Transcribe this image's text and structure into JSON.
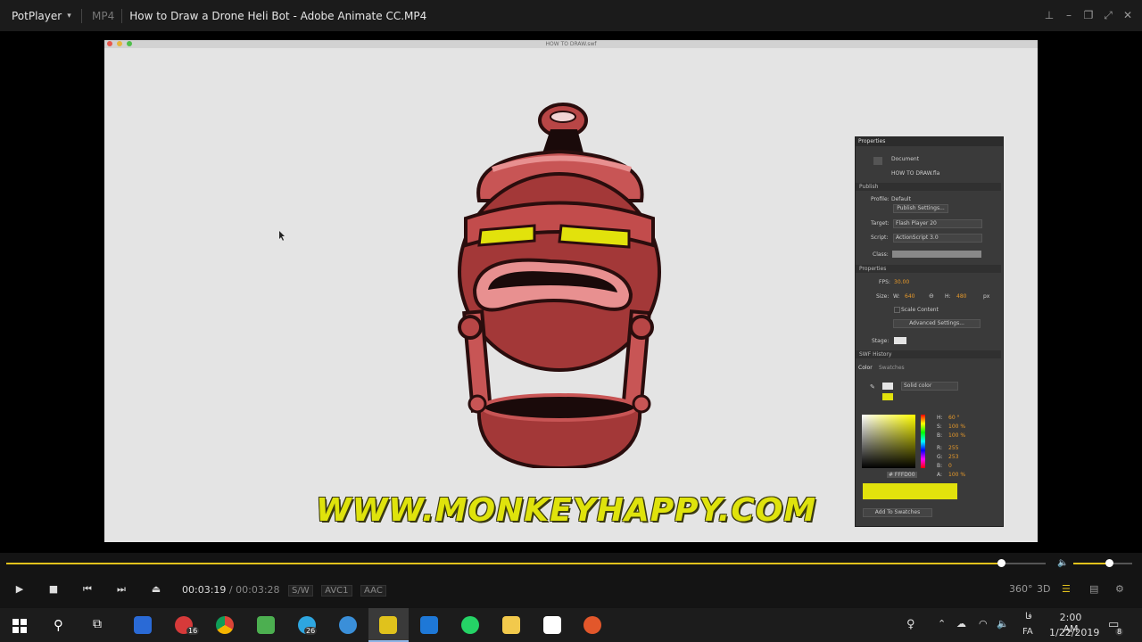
{
  "app": {
    "name": "PotPlayer",
    "format": "MP4",
    "title": "How to Draw a Drone Heli Bot - Adobe Animate CC.MP4"
  },
  "swf": {
    "window_title": "HOW TO DRAW.swf",
    "url_text": "WWW.MONKEYHAPPY.COM",
    "panel": {
      "tab": "Properties",
      "document_label": "Document",
      "document_file": "HOW TO DRAW.fla",
      "publish_section": "Publish",
      "profile_label": "Profile:",
      "profile_value": "Default",
      "publish_settings": "Publish Settings...",
      "target_label": "Target:",
      "target_value": "Flash Player 20",
      "script_label": "Script:",
      "script_value": "ActionScript 3.0",
      "class_label": "Class:",
      "properties_section": "Properties",
      "fps_label": "FPS:",
      "fps_value": "30.00",
      "size_label": "Size:",
      "w_label": "W:",
      "w_value": "640",
      "h_label": "H:",
      "h_value": "480",
      "px_label": "px",
      "scale_content": "Scale Content",
      "advanced_settings": "Advanced Settings...",
      "stage_label": "Stage:",
      "swf_history": "SWF History",
      "color_tab": "Color",
      "swatches_tab": "Swatches",
      "solid_color": "Solid color",
      "h": "H:",
      "h_val": "60 °",
      "s": "S:",
      "s_val": "100 %",
      "b": "B:",
      "b_val": "100 %",
      "r": "R:",
      "r_val": "255",
      "g": "G:",
      "g_val": "253",
      "b2": "B:",
      "b2_val": "0",
      "a": "A:",
      "a_val": "100 %",
      "hex": "# FFFD00",
      "add_swatches": "Add To Swatches"
    }
  },
  "player": {
    "current_time": "00:03:19",
    "separator": "/",
    "total_time": "00:03:28",
    "badges": [
      "S/W",
      "AVC1",
      "AAC"
    ],
    "progress": 0.957,
    "volume": 0.6,
    "accent": "#e2c21c",
    "labels": {
      "three_sixty": "360°",
      "three_d": "3D"
    }
  },
  "taskbar": {
    "badges": {
      "mail": "16",
      "telegram": "26"
    },
    "tray": {
      "lang_top": "فا",
      "lang": "FA",
      "time": "2:00 AM",
      "date": "1/22/2019",
      "notifications": "8"
    }
  }
}
